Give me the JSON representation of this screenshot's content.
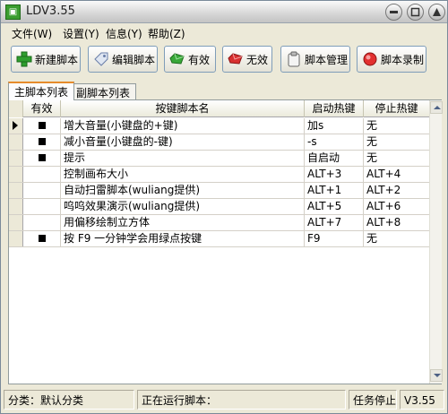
{
  "window": {
    "title": "LDV3.55",
    "icon": "app-logo-icon"
  },
  "menu": [
    {
      "label": "文件(W)"
    },
    {
      "label": "设置(Y)"
    },
    {
      "label": "信息(Y)"
    },
    {
      "label": "帮助(Z)"
    }
  ],
  "toolbar": [
    {
      "label": "新建脚本",
      "icon": "plus-icon"
    },
    {
      "label": "编辑脚本",
      "icon": "tag-icon"
    },
    {
      "label": "有效",
      "icon": "green-gem-icon"
    },
    {
      "label": "无效",
      "icon": "red-gem-icon"
    },
    {
      "label": "脚本管理",
      "icon": "clipboard-icon"
    },
    {
      "label": "脚本录制",
      "icon": "record-icon"
    }
  ],
  "tabs": [
    {
      "label": "主脚本列表",
      "active": true
    },
    {
      "label": "副脚本列表",
      "active": false
    }
  ],
  "grid": {
    "columns": [
      "有效",
      "按键脚本名",
      "启动热键",
      "停止热键"
    ],
    "rows": [
      {
        "current": true,
        "enabled": true,
        "name": "增大音量(小键盘的+键)",
        "start": "加s",
        "stop": "无"
      },
      {
        "current": false,
        "enabled": true,
        "name": "减小音量(小键盘的-键)",
        "start": "-s",
        "stop": "无"
      },
      {
        "current": false,
        "enabled": true,
        "name": "提示",
        "start": "自启动",
        "stop": "无"
      },
      {
        "current": false,
        "enabled": false,
        "name": "控制画布大小",
        "start": "ALT+3",
        "stop": "ALT+4"
      },
      {
        "current": false,
        "enabled": false,
        "name": "自动扫雷脚本(wuliang提供)",
        "start": "ALT+1",
        "stop": "ALT+2"
      },
      {
        "current": false,
        "enabled": false,
        "name": "呜呜效果演示(wuliang提供)",
        "start": "ALT+5",
        "stop": "ALT+6"
      },
      {
        "current": false,
        "enabled": false,
        "name": "用偏移绘制立方体",
        "start": "ALT+7",
        "stop": "ALT+8"
      },
      {
        "current": false,
        "enabled": true,
        "name": "按 F9 一分钟学会用绿点按键",
        "start": "F9",
        "stop": "无"
      }
    ]
  },
  "status": {
    "category": "分类：默认分类",
    "running": "正在运行脚本：",
    "task": "任务停止",
    "version": "V3.55"
  },
  "colors": {
    "enabled_mark": "#000000",
    "tab_accent": "#e68b2c"
  }
}
